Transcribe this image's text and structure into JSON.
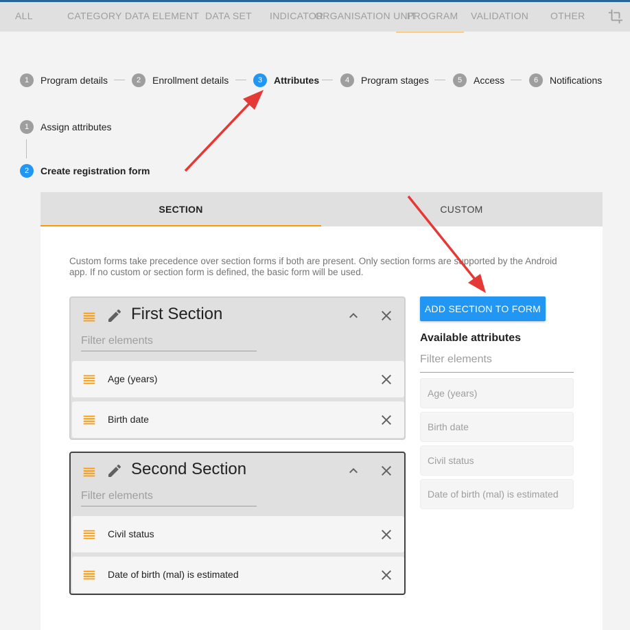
{
  "top_tabs": [
    "ALL",
    "CATEGORY",
    "DATA ELEMENT",
    "DATA SET",
    "INDICATOR",
    "ORGANISATION UNIT",
    "PROGRAM",
    "VALIDATION",
    "OTHER"
  ],
  "active_top_tab": "PROGRAM",
  "stepper": [
    {
      "num": "1",
      "label": "Program details"
    },
    {
      "num": "2",
      "label": "Enrollment details"
    },
    {
      "num": "3",
      "label": "Attributes"
    },
    {
      "num": "4",
      "label": "Program stages"
    },
    {
      "num": "5",
      "label": "Access"
    },
    {
      "num": "6",
      "label": "Notifications"
    }
  ],
  "substeps": [
    {
      "num": "1",
      "label": "Assign attributes"
    },
    {
      "num": "2",
      "label": "Create registration form"
    }
  ],
  "form_tabs": {
    "section": "SECTION",
    "custom": "CUSTOM"
  },
  "info_text": "Custom forms take precedence over section forms if both are present. Only section forms are supported by the Android app. If no custom or section form is defined, the basic form will be used.",
  "sections": [
    {
      "title": "First Section",
      "filter_placeholder": "Filter elements",
      "elements": [
        "Age (years)",
        "Birth date"
      ]
    },
    {
      "title": "Second Section",
      "filter_placeholder": "Filter elements",
      "elements": [
        "Civil status",
        "Date of birth (mal) is estimated"
      ]
    }
  ],
  "add_section_button": "ADD SECTION TO FORM",
  "available": {
    "title": "Available attributes",
    "filter_placeholder": "Filter elements",
    "items": [
      "Age (years)",
      "Birth date",
      "Civil status",
      "Date of birth (mal) is estimated"
    ]
  },
  "colors": {
    "accent_orange": "#ff9800",
    "primary_blue": "#2196f3",
    "arrow_red": "#e53935",
    "header_blue": "#276696"
  },
  "icons": [
    "crop-icon",
    "drag-handle-icon",
    "edit-pencil-icon",
    "chevron-up-icon",
    "close-icon"
  ]
}
